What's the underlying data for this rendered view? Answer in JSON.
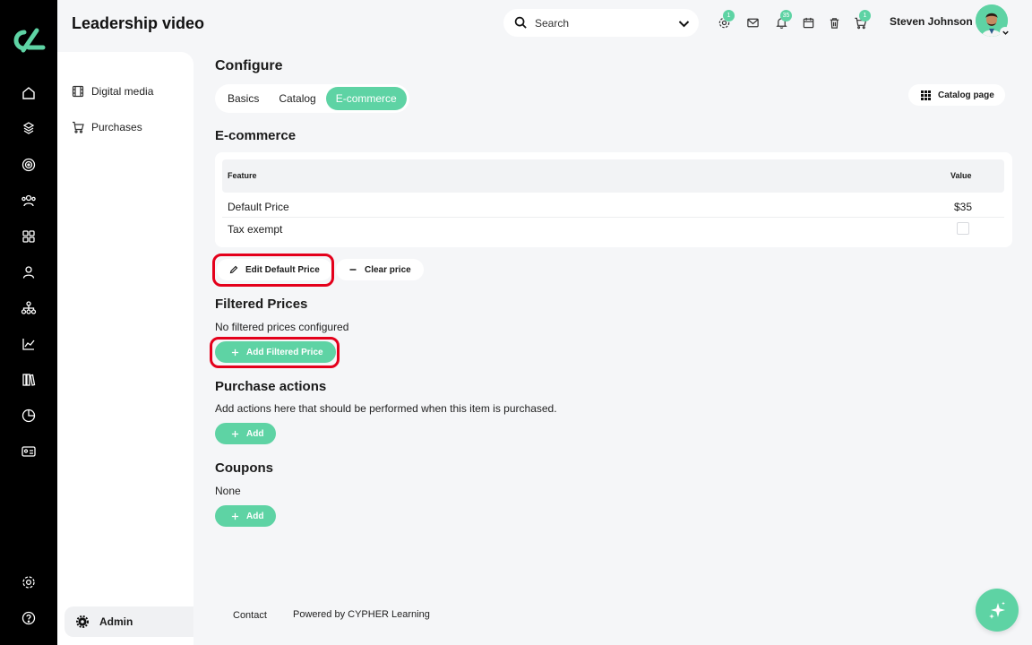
{
  "app": {
    "title": "Leadership video",
    "brand_color": "#5ed3a4",
    "alert_color": "#e4001b"
  },
  "rail": {
    "logo": "cypher-logo",
    "items": [
      "home-icon",
      "courses-icon",
      "target-icon",
      "people-icon",
      "apps-grid-icon",
      "person-icon",
      "org-chart-icon",
      "analytics-icon",
      "library-icon",
      "pie-chart-icon",
      "id-card-icon"
    ],
    "bottom": [
      "settings-icon",
      "help-icon"
    ]
  },
  "header": {
    "search_placeholder": "Search",
    "icons": [
      {
        "name": "gear-icon",
        "badge": "1"
      },
      {
        "name": "mail-icon",
        "badge": ""
      },
      {
        "name": "bell-icon",
        "badge": "35"
      },
      {
        "name": "calendar-icon",
        "badge": ""
      },
      {
        "name": "trash-icon",
        "badge": ""
      },
      {
        "name": "cart-icon",
        "badge": "1"
      }
    ],
    "user_name": "Steven Johnson"
  },
  "sidebar": {
    "items": [
      {
        "label": "Digital media",
        "icon": "film-icon"
      },
      {
        "label": "Purchases",
        "icon": "cart-icon"
      }
    ],
    "admin_label": "Admin"
  },
  "main": {
    "title": "Configure",
    "tabs": [
      {
        "label": "Basics",
        "active": false
      },
      {
        "label": "Catalog",
        "active": false
      },
      {
        "label": "E-commerce",
        "active": true
      }
    ],
    "catalog_page_label": "Catalog page",
    "ecommerce": {
      "title": "E-commerce",
      "columns": [
        "Feature",
        "Value"
      ],
      "rows": [
        {
          "feature": "Default Price",
          "value": "$35"
        },
        {
          "feature": "Tax exempt",
          "value": ""
        }
      ],
      "edit_default_price": "Edit Default Price",
      "clear_price": "Clear price"
    },
    "filtered_prices": {
      "title": "Filtered Prices",
      "empty_text": "No filtered prices configured",
      "add_label": "Add Filtered Price"
    },
    "purchase_actions": {
      "title": "Purchase actions",
      "description": "Add actions here that should be performed when this item is purchased.",
      "add_label": "Add"
    },
    "coupons": {
      "title": "Coupons",
      "value": "None",
      "add_label": "Add"
    }
  },
  "footer": {
    "contact": "Contact",
    "powered_by": "Powered by CYPHER Learning"
  }
}
